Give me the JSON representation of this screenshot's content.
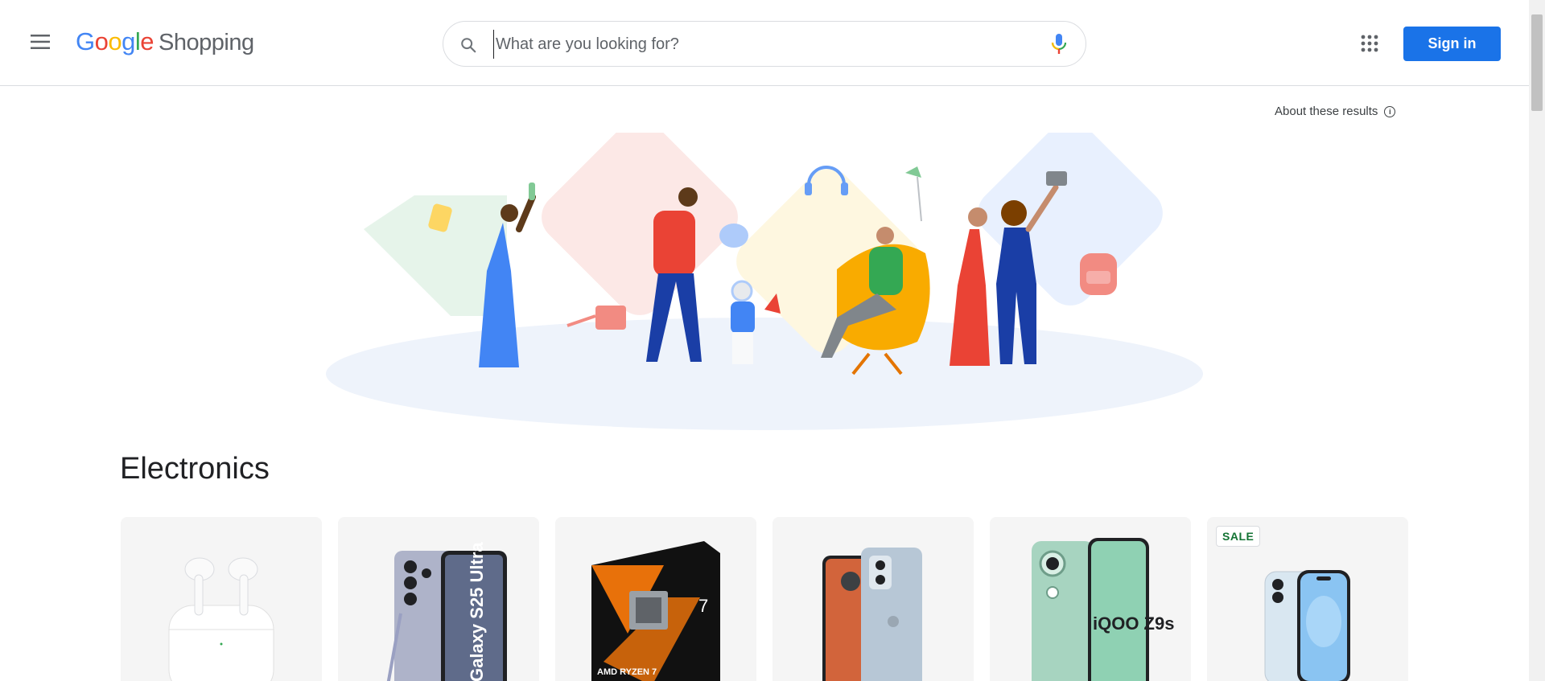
{
  "header": {
    "logo_google": [
      "G",
      "o",
      "o",
      "g",
      "l",
      "e"
    ],
    "logo_product": "Shopping",
    "search_placeholder": "What are you looking for?",
    "signin_label": "Sign in"
  },
  "about": {
    "label": "About these results",
    "info_glyph": "i"
  },
  "section": {
    "title": "Electronics"
  },
  "products": [
    {
      "name": "airpods-pro",
      "badge": ""
    },
    {
      "name": "galaxy-s25-ultra",
      "badge": "",
      "printed_text": "Galaxy S25 Ultra"
    },
    {
      "name": "amd-ryzen-box",
      "badge": "",
      "printed_text": "AMD RYZEN 7"
    },
    {
      "name": "motorola-phone",
      "badge": ""
    },
    {
      "name": "iqoo-z9s",
      "badge": "",
      "printed_text": "iQOO Z9s"
    },
    {
      "name": "iphone-15",
      "badge": "SALE"
    }
  ],
  "colors": {
    "accent": "#1a73e8",
    "sale_green": "#137333"
  },
  "icons": [
    "menu-icon",
    "search-icon",
    "mic-icon",
    "apps-grid-icon",
    "info-icon"
  ]
}
